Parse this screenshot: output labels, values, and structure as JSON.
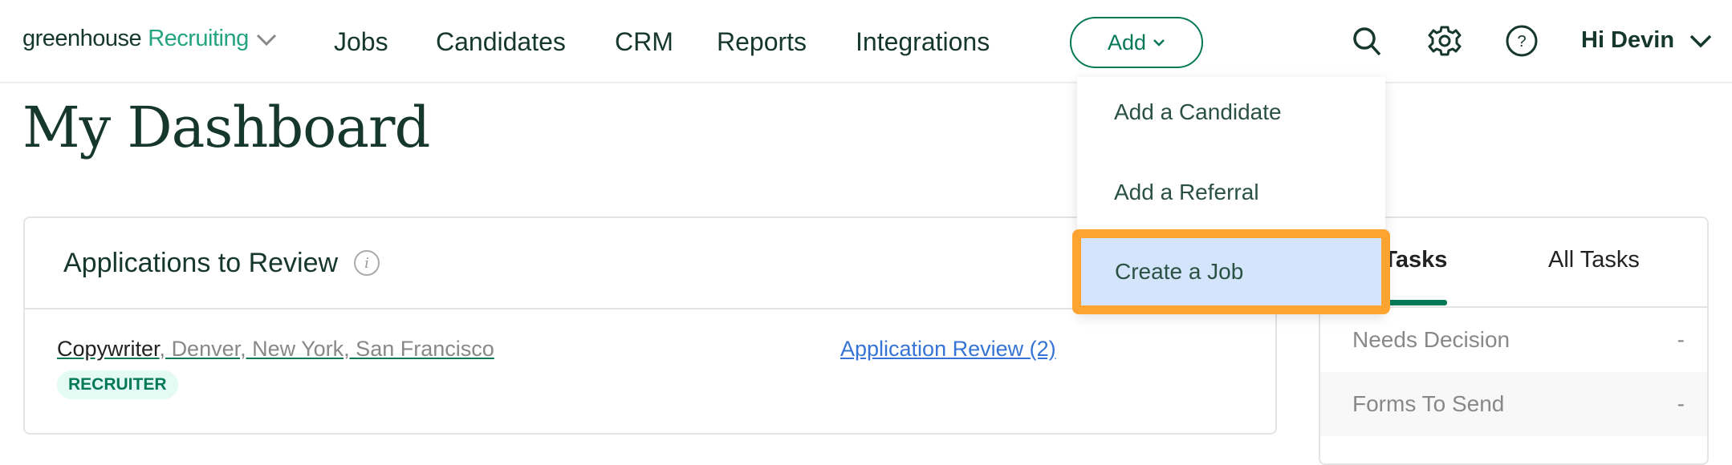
{
  "nav": {
    "brand": "greenhouse",
    "product": "Recruiting",
    "links": [
      "Jobs",
      "Candidates",
      "CRM",
      "Reports",
      "Integrations"
    ],
    "add_label": "Add",
    "user_greeting": "Hi Devin",
    "icons": [
      "search-icon",
      "gear-icon",
      "help-icon"
    ]
  },
  "add_menu": {
    "items": [
      "Add a Candidate",
      "Add a Referral",
      "Create a Job"
    ],
    "highlighted": "Create a Job"
  },
  "page": {
    "title": "My Dashboard"
  },
  "applications_card": {
    "title": "Applications to Review",
    "rows": [
      {
        "job": "Copywriter",
        "locations": "Denver, New York, San Francisco",
        "role_badge": "RECRUITER",
        "review_link": "Application Review (2)"
      }
    ]
  },
  "tasks_card": {
    "tabs": [
      "My Tasks",
      "All Tasks"
    ],
    "active_tab": "My Tasks",
    "rows": [
      {
        "label": "Needs Decision",
        "count": "-"
      },
      {
        "label": "Forms To Send",
        "count": "-"
      }
    ]
  },
  "colors": {
    "brand_green": "#047957",
    "accent_green": "#24a47f",
    "link_blue": "#3574d6",
    "highlight_orange": "#fca42f",
    "highlight_fill": "#d4e4fb"
  }
}
